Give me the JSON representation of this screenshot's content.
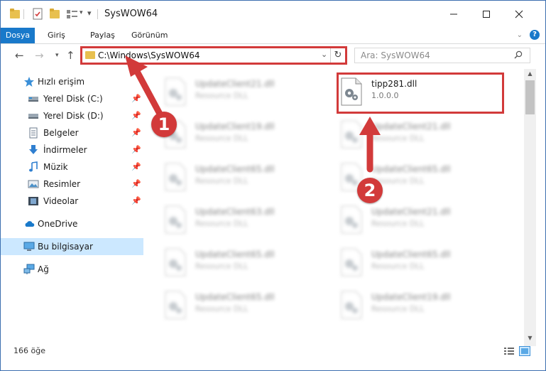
{
  "window": {
    "title": "SysWOW64"
  },
  "ribbon": {
    "tabs": [
      "Dosya",
      "Giriş",
      "Paylaş",
      "Görünüm"
    ]
  },
  "address": {
    "path": "C:\\Windows\\SysWOW64"
  },
  "search": {
    "placeholder": "Ara: SysWOW64"
  },
  "nav": {
    "items": [
      {
        "label": "Hızlı erişim",
        "icon": "star-icon",
        "pinned": false
      },
      {
        "label": "Yerel Disk (C:)",
        "icon": "drive-icon",
        "pinned": true
      },
      {
        "label": "Yerel Disk (D:)",
        "icon": "drive-icon",
        "pinned": true
      },
      {
        "label": "Belgeler",
        "icon": "documents-icon",
        "pinned": true
      },
      {
        "label": "İndirmeler",
        "icon": "download-icon",
        "pinned": true
      },
      {
        "label": "Müzik",
        "icon": "music-icon",
        "pinned": true
      },
      {
        "label": "Resimler",
        "icon": "pictures-icon",
        "pinned": true
      },
      {
        "label": "Videolar",
        "icon": "video-icon",
        "pinned": true
      },
      {
        "label": "OneDrive",
        "icon": "cloud-icon",
        "pinned": false
      },
      {
        "label": "Bu bilgisayar",
        "icon": "computer-icon",
        "pinned": false,
        "selected": true
      },
      {
        "label": "Ağ",
        "icon": "network-icon",
        "pinned": false
      }
    ]
  },
  "files": {
    "left_column": [
      {
        "name": "UpdateClient21.dll",
        "desc": "Resource DLL"
      },
      {
        "name": "UpdateClient19.dll",
        "desc": "Resource DLL"
      },
      {
        "name": "UpdateClient65.dll",
        "desc": "Resource DLL"
      },
      {
        "name": "UpdateClient63.dll",
        "desc": "Resource DLL"
      },
      {
        "name": "UpdateClient65.dll",
        "desc": "Resource DLL"
      },
      {
        "name": "UpdateClient65.dll",
        "desc": "Resource DLL"
      }
    ],
    "right_column": [
      {
        "name": "tipp281.dll",
        "desc": "1.0.0.0",
        "highlighted": true
      },
      {
        "name": "UpdateClient21.dll",
        "desc": "Resource DLL"
      },
      {
        "name": "UpdateClient65.dll",
        "desc": "Resource DLL"
      },
      {
        "name": "UpdateClient21.dll",
        "desc": "Resource DLL"
      },
      {
        "name": "UpdateClient65.dll",
        "desc": "Resource DLL"
      },
      {
        "name": "UpdateClient19.dll",
        "desc": "Resource DLL"
      }
    ]
  },
  "status": {
    "count": "166 öğe"
  },
  "annotations": {
    "callout_1": "1",
    "callout_2": "2",
    "color": "#d23a3a"
  },
  "colors": {
    "accent": "#1979ca",
    "selection": "#cce8ff",
    "highlight": "#d23a3a"
  }
}
